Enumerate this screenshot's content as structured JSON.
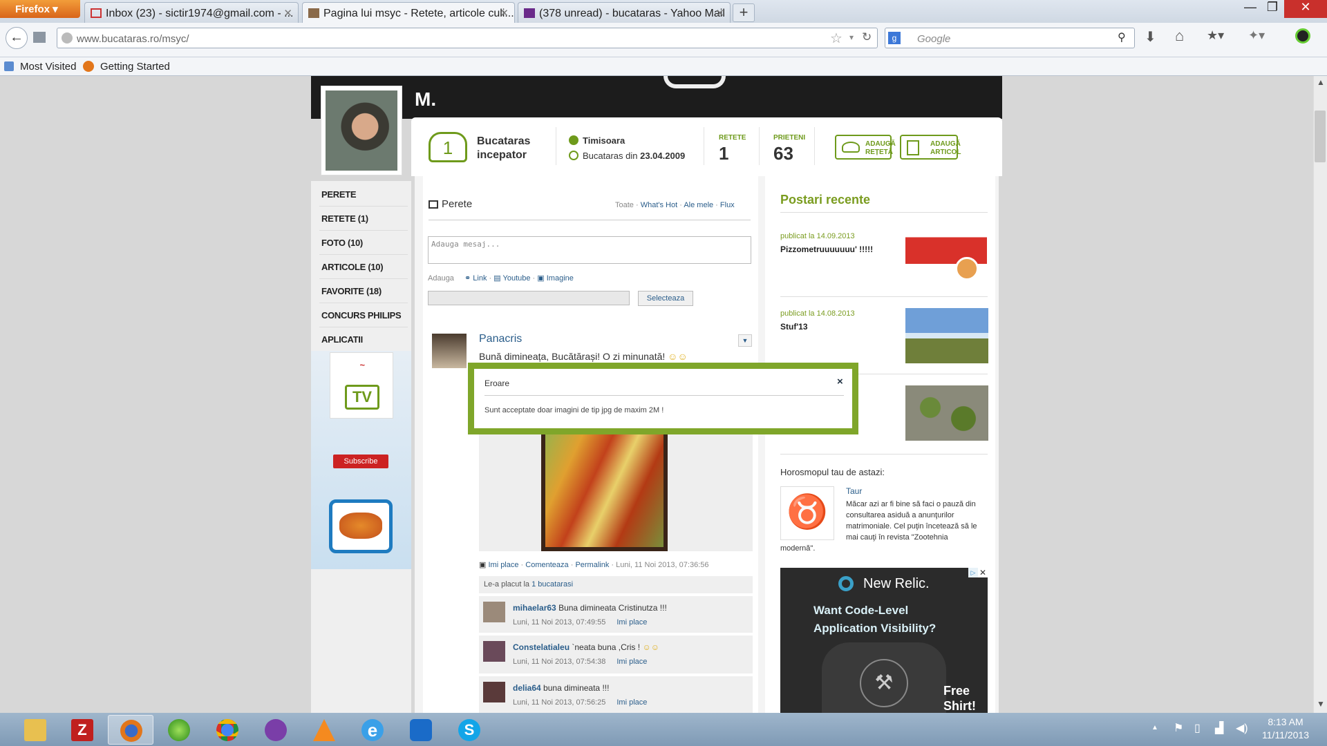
{
  "browser": {
    "menu_button": "Firefox",
    "tabs": [
      {
        "title": "Inbox (23) - sictir1974@gmail.com - ...",
        "icon": "gmail-icon"
      },
      {
        "title": "Pagina lui msyc - Retete, articole culi...",
        "icon": "bucataras-icon"
      },
      {
        "title": "(378 unread) - bucataras - Yahoo Mail",
        "icon": "yahoo-mail-icon"
      }
    ],
    "url": "www.bucataras.ro/msyc/",
    "search_placeholder": "Google",
    "bookmarks": [
      "Most Visited",
      "Getting Started"
    ]
  },
  "profile": {
    "name": "M.",
    "level_number": "1",
    "level_line1": "Bucataras",
    "level_line2": "incepator",
    "city": "Timisoara",
    "member_since_prefix": "Bucataras din ",
    "member_since_date": "23.04.2009",
    "stats": [
      {
        "label": "RETETE",
        "value": "1"
      },
      {
        "label": "PRIETENI",
        "value": "63"
      }
    ],
    "buttons": [
      {
        "line1": "ADAUGĂ",
        "line2": "REȚETĂ"
      },
      {
        "line1": "ADAUGĂ",
        "line2": "ARTICOL"
      }
    ]
  },
  "sidebar": {
    "items": [
      "PERETE",
      "RETETE (1)",
      "FOTO (10)",
      "ARTICOLE (10)",
      "FAVORITE (18)",
      "CONCURS PHILIPS",
      "APLICATII"
    ],
    "subscribe": "Subscribe"
  },
  "wall": {
    "title": "Perete",
    "filters": [
      "Toate",
      "What's Hot",
      "Ale mele",
      "Flux"
    ],
    "message_placeholder": "Adauga mesaj...",
    "add_label": "Adauga",
    "add_options": [
      "Link",
      "Youtube",
      "Imagine"
    ],
    "select_button": "Selecteaza",
    "post": {
      "author": "Panacris",
      "text": "Bună dimineața, Bucătărași! O zi minunată!",
      "actions": [
        "Imi place",
        "Comenteaza",
        "Permalink"
      ],
      "timestamp": "Luni, 11 Noi 2013, 07:36:56",
      "likes_prefix": "Le-a placut la ",
      "likes_link": "1 bucatarasi"
    },
    "comments": [
      {
        "author": "mihaelar63",
        "text": "Buna dimineata Cristinutza !!!",
        "time": "Luni, 11 Noi 2013, 07:49:55",
        "like": "Imi place"
      },
      {
        "author": "Constelatialeu",
        "text": "`neata buna ,Cris !",
        "time": "Luni, 11 Noi 2013, 07:54:38",
        "like": "Imi place"
      },
      {
        "author": "delia64",
        "text": "buna dimineata !!!",
        "time": "Luni, 11 Noi 2013, 07:56:25",
        "like": "Imi place"
      }
    ]
  },
  "recent": {
    "title": "Postari recente",
    "posts": [
      {
        "date": "publicat la 14.09.2013",
        "title": "Pizzometruuuuuuu' !!!!!"
      },
      {
        "date": "publicat la 14.08.2013",
        "title": "Stuf'13"
      }
    ],
    "horoscope_title": "Horosmopul tau de astazi:",
    "horoscope_sign": "Taur",
    "horoscope_text_lines": [
      "Măcar azi ar fi bine să faci o pauză din",
      "consultarea asiduă a anunţurilor",
      "matrimoniale. Cel puţin încetează să le",
      "mai cauţi în revista \"Zootehnia"
    ],
    "horoscope_text_last": "modernă\".",
    "ad": {
      "brand": "New Relic.",
      "line1": "Want  Code-Level",
      "line2": "Application Visibility?",
      "cta1": "Free",
      "cta2": "Shirt!"
    }
  },
  "modal": {
    "title": "Eroare",
    "close": "×",
    "message": "Sunt acceptate doar imagini de tip jpg de maxim 2M !"
  },
  "taskbar": {
    "time": "8:13 AM",
    "date": "11/11/2013"
  }
}
